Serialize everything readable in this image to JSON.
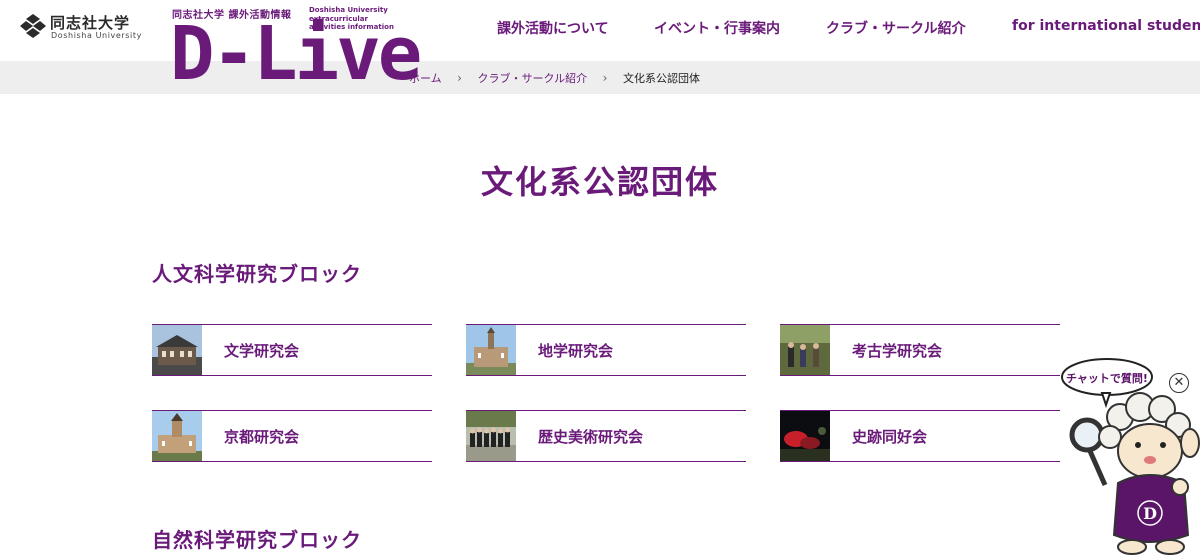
{
  "header": {
    "university_logo_jp": "同志社大学",
    "university_logo_en": "Doshisha University",
    "site_sub_jp": "同志社大学 課外活動情報",
    "site_sub_en": "Doshisha University\nextracurricular\nactivities information",
    "site_logo": "D-Live",
    "nav": [
      {
        "label": "課外活動について"
      },
      {
        "label": "イベント・行事案内"
      },
      {
        "label": "クラブ・サークル紹介"
      },
      {
        "label": "for international students"
      }
    ],
    "brand_color": "#6a1b7a"
  },
  "breadcrumb": {
    "items": [
      "ホーム",
      "クラブ・サークル紹介"
    ],
    "current": "文化系公認団体",
    "separator_icon": "chevron-right-icon"
  },
  "main": {
    "title": "文化系公認団体",
    "blocks": [
      {
        "title": "人文科学研究ブロック",
        "cards": [
          {
            "label": "文学研究会"
          },
          {
            "label": "地学研究会"
          },
          {
            "label": "考古学研究会"
          },
          {
            "label": "京都研究会"
          },
          {
            "label": "歴史美術研究会"
          },
          {
            "label": "史跡同好会"
          }
        ]
      },
      {
        "title": "自然科学研究ブロック"
      }
    ]
  },
  "chat_widget": {
    "bubble_text": "チャットで質問!",
    "close_icon": "close-icon",
    "mascot_letter": "D"
  }
}
